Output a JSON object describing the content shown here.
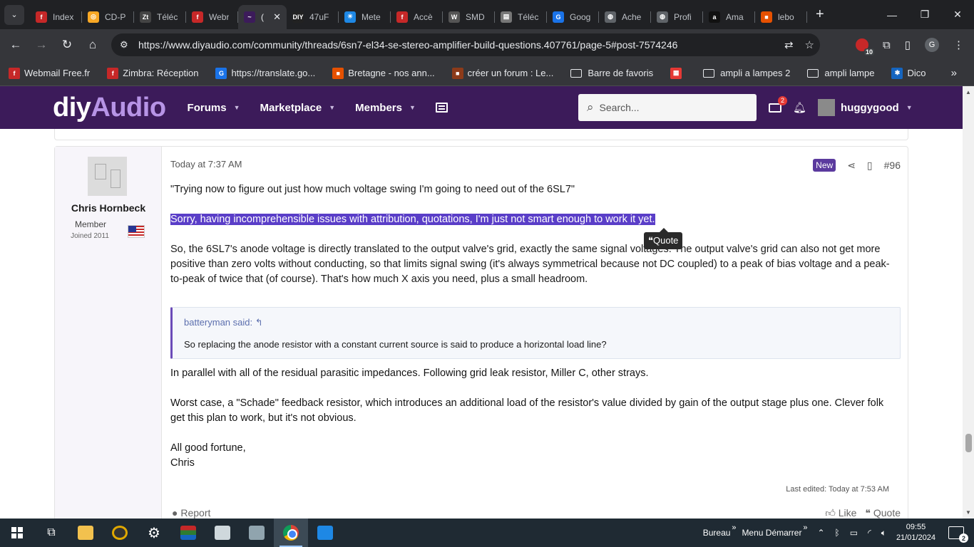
{
  "browser": {
    "tabs": [
      {
        "title": "Index",
        "color": "#c62828",
        "glyph": "f"
      },
      {
        "title": "CD-P",
        "color": "#f9a825",
        "glyph": "◎"
      },
      {
        "title": "Téléc",
        "color": "#444444",
        "glyph": "Zt"
      },
      {
        "title": "Webr",
        "color": "#c62828",
        "glyph": "f"
      },
      {
        "title": "(",
        "color": "#3c1b5a",
        "glyph": "~",
        "active": true
      },
      {
        "title": "47uF",
        "color": "#222222",
        "glyph": "DIY"
      },
      {
        "title": "Mete",
        "color": "#1e88e5",
        "glyph": "☀"
      },
      {
        "title": "Accè",
        "color": "#c62828",
        "glyph": "f"
      },
      {
        "title": "SMD",
        "color": "#555555",
        "glyph": "W"
      },
      {
        "title": "Téléc",
        "color": "#777777",
        "glyph": "▤"
      },
      {
        "title": "Goog",
        "color": "#1a73e8",
        "glyph": "G"
      },
      {
        "title": "Ache",
        "color": "#5f6368",
        "glyph": "◍"
      },
      {
        "title": "Profi",
        "color": "#5f6368",
        "glyph": "◍"
      },
      {
        "title": "Ama",
        "color": "#111111",
        "glyph": "a"
      },
      {
        "title": "lebo",
        "color": "#e65100",
        "glyph": "■"
      }
    ],
    "url": "https://www.diyaudio.com/community/threads/6sn7-el34-se-stereo-amplifier-build-questions.407761/page-5#post-7574246",
    "extension_badge": "10",
    "profile_initial": "G",
    "bookmarks": [
      {
        "label": "Webmail Free.fr",
        "type": "site",
        "color": "#c62828",
        "glyph": "f"
      },
      {
        "label": "Zimbra: Réception",
        "type": "site",
        "color": "#c62828",
        "glyph": "f"
      },
      {
        "label": "https://translate.go...",
        "type": "site",
        "color": "#1a73e8",
        "glyph": "G"
      },
      {
        "label": "Bretagne - nos ann...",
        "type": "site",
        "color": "#e65100",
        "glyph": "■"
      },
      {
        "label": "créer un forum : Le...",
        "type": "site",
        "color": "#8d3b1a",
        "glyph": "■"
      },
      {
        "label": "Barre de favoris",
        "type": "folder"
      },
      {
        "label": "",
        "type": "site",
        "color": "#e53935",
        "glyph": "▦"
      },
      {
        "label": "ampli a lampes 2",
        "type": "folder"
      },
      {
        "label": "ampli lampe",
        "type": "folder"
      },
      {
        "label": "Dico",
        "type": "site",
        "color": "#1565c0",
        "glyph": "✱"
      }
    ]
  },
  "site": {
    "logo_a": "diy",
    "logo_b": "Audio",
    "nav": [
      "Forums",
      "Marketplace",
      "Members"
    ],
    "search_placeholder": "Search...",
    "mail_count": "2",
    "username": "huggygood",
    "colors": {
      "header_bg": "#3c1b5a",
      "accent": "#5b3a9e"
    }
  },
  "post": {
    "author": "Chris Hornbeck",
    "author_title": "Member",
    "author_joined": "Joined 2011",
    "timestamp": "Today at 7:37 AM",
    "badge": "New",
    "post_number": "#96",
    "line1": "\"Trying now to figure out just how much voltage swing I'm going to need out of the 6SL7\"",
    "highlighted": "Sorry, having incomprehensible issues with attribution, quotations, I'm just not smart enough to work it yet.",
    "quote_popup": "Quote",
    "para2": "So, the 6SL7's anode voltage is directly translated to the output valve's grid, exactly the same signal voltages. The output valve's grid can also not get more positive than zero volts without conducting, so that limits signal swing (it's always symmetrical because not DC coupled) to a peak of bias voltage and a peak-to-peak of twice that (of course). That's how much X axis you need, plus a small headroom.",
    "quote_attr": "batteryman said:",
    "quote_text": "So replacing the anode resistor with a constant current source is said to produce a horizontal load line?",
    "para3": "In parallel with all of the residual parasitic impedances. Following grid leak resistor, Miller C, other strays.",
    "para4": "Worst case, a \"Schade\" feedback resistor, which introduces an additional load of the resistor's value divided by gain of the output stage plus one. Clever folk get this plan to work, but it's not obvious.",
    "sign1": "All good fortune,",
    "sign2": "Chris",
    "last_edited": "Last edited: Today at 7:53 AM",
    "report": "Report",
    "like": "Like",
    "quote": "Quote"
  },
  "taskbar": {
    "links": [
      "Bureau",
      "Menu Démarrer"
    ],
    "time": "09:55",
    "date": "21/01/2024",
    "notifications": "2"
  }
}
